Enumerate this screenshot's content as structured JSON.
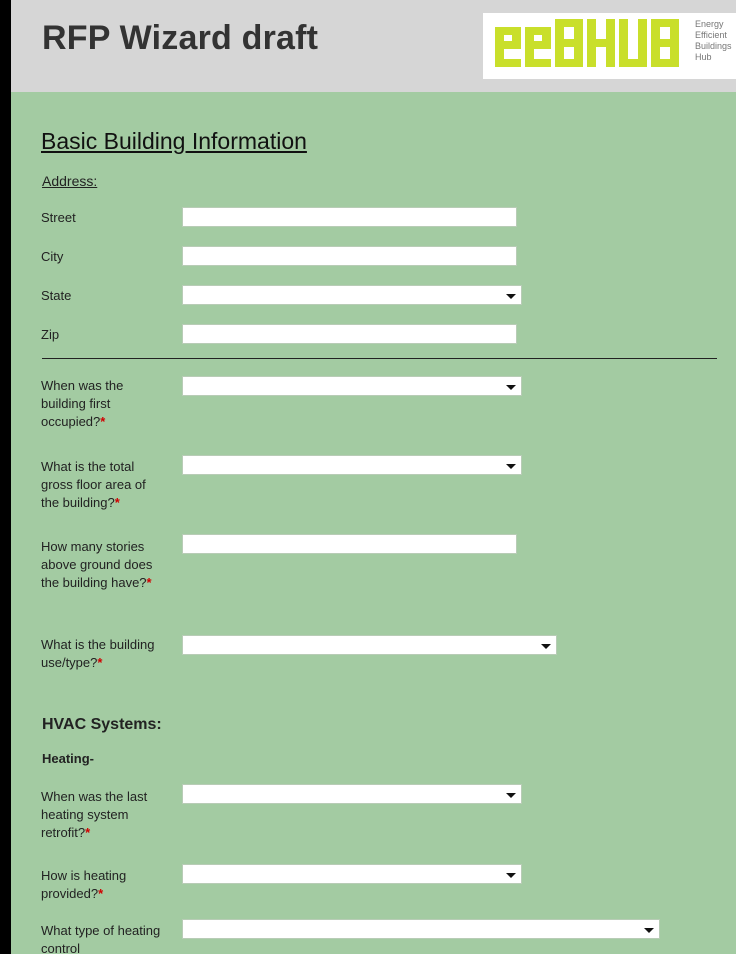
{
  "header": {
    "title": "RFP Wizard draft"
  },
  "logo": {
    "mark": "eeBHUB",
    "tagline": [
      "Energy",
      "Efficient",
      "Buildings",
      "Hub"
    ]
  },
  "colors": {
    "header_bg": "#d6d6d6",
    "form_bg": "#a3cba2",
    "logo_green": "#c9df2b",
    "required": "#d00000"
  },
  "form": {
    "section_title": "Basic Building Information",
    "address_heading": "Address:",
    "address": {
      "street_label": "Street",
      "city_label": "City",
      "state_label": "State",
      "zip_label": "Zip"
    },
    "questions": {
      "first_occupied": "When was the building first occupied?",
      "gross_floor_area": "What is the total gross floor area of the building?",
      "stories": "How many stories above ground does the building have?",
      "use_type": "What is the building use/type?"
    },
    "required_marker": "*",
    "hvac_heading": "HVAC Systems:",
    "heating_heading": "Heating-",
    "heating": {
      "last_retrofit": "When was the last heating system retrofit?",
      "provided": "How is heating provided?",
      "control_type": "What type of heating control"
    }
  }
}
